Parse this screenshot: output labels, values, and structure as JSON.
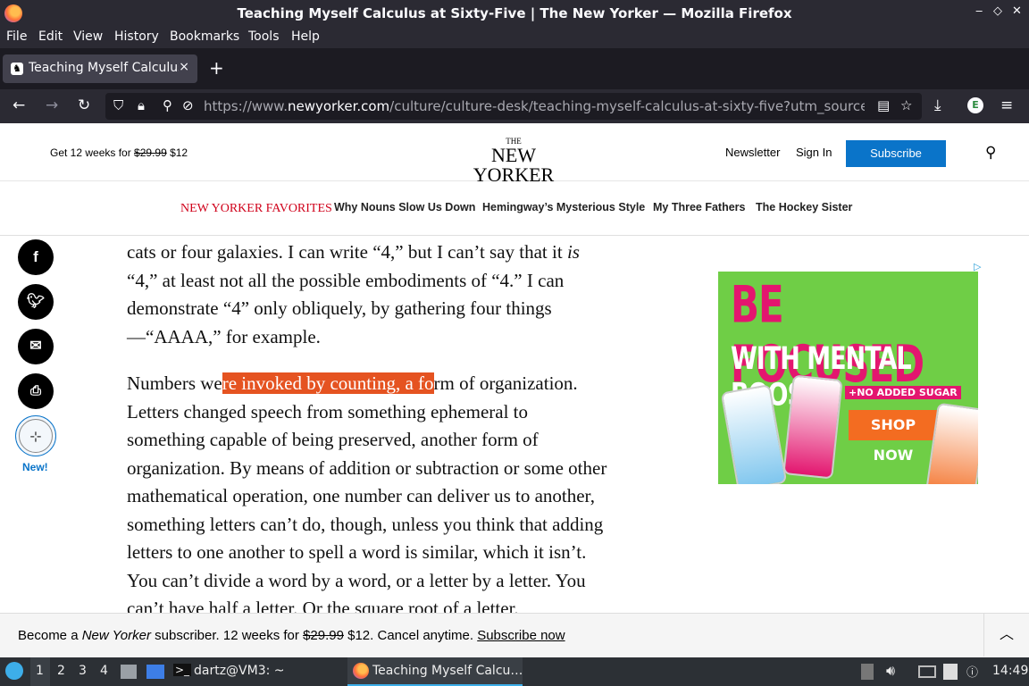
{
  "window": {
    "title": "Teaching Myself Calculus at Sixty-Five | The New Yorker — Mozilla Firefox"
  },
  "menu": [
    "File",
    "Edit",
    "View",
    "History",
    "Bookmarks",
    "Tools",
    "Help"
  ],
  "tab": {
    "label": "Teaching Myself Calculus at Sixty-Five",
    "close": "×",
    "new_tab": "+"
  },
  "urlbar": {
    "prefix": "https://www.",
    "domain": "newyorker.com",
    "path": "/culture/culture-desk/teaching-myself-calculus-at-sixty-five?utm_source=pocket"
  },
  "header": {
    "promo_prefix": "Get 12 weeks for ",
    "promo_old_price": "$29.99",
    "promo_new_price": " $12",
    "logo_the": "THE",
    "logo_name": "NEW YORKER",
    "newsletter": "Newsletter",
    "sign_in": "Sign In",
    "subscribe": "Subscribe"
  },
  "favorites": {
    "title": "NEW YORKER FAVORITES",
    "links": [
      "Why Nouns Slow Us Down",
      "Hemingway’s Mysterious Style",
      "My Three Fathers",
      "The Hockey Sister"
    ]
  },
  "social": {
    "facebook": "f",
    "save_new": "New!"
  },
  "article": {
    "p1_a": "cats or four galaxies. I can write “4,” but I can’t say that it ",
    "p1_em": "is",
    "p1_b": " “4,” at least not all the possible embodiments of “4.” I can demonstrate “4” only obliquely, by gathering four things —“AAAA,” for example.",
    "p2_a": "Numbers we",
    "p2_hl": "re invoked by counting, a fo",
    "p2_b": "rm of organization. Letters changed speech from something ephemeral to something capable of being preserved, another form of organization. By means of addition or subtraction or some other mathematical operation, one number can deliver us to another, something letters can’t do, though, unless you think that adding letters to one another to spell a word is similar, which it isn’t. You can’t divide a word by a word, or a letter by a letter. You can’t have half a letter. Or the square root of a letter."
  },
  "ad": {
    "line1": "BE FOCUSED",
    "line2": "WITH MENTAL BOOST",
    "line3": "+NO ADDED SUGAR",
    "cta": "SHOP NOW"
  },
  "subscribe_bar": {
    "text_a": "Become a ",
    "text_em": "New Yorker",
    "text_b": " subscriber. 12 weeks for ",
    "old_price": "$29.99",
    "text_c": " $12. Cancel anytime. ",
    "link": "Subscribe now"
  },
  "taskbar": {
    "workspaces": [
      "1",
      "2",
      "3",
      "4"
    ],
    "terminal": "dartz@VM3: ~",
    "firefox_window": "Teaching Myself Calcu…",
    "clock": "14:49"
  }
}
